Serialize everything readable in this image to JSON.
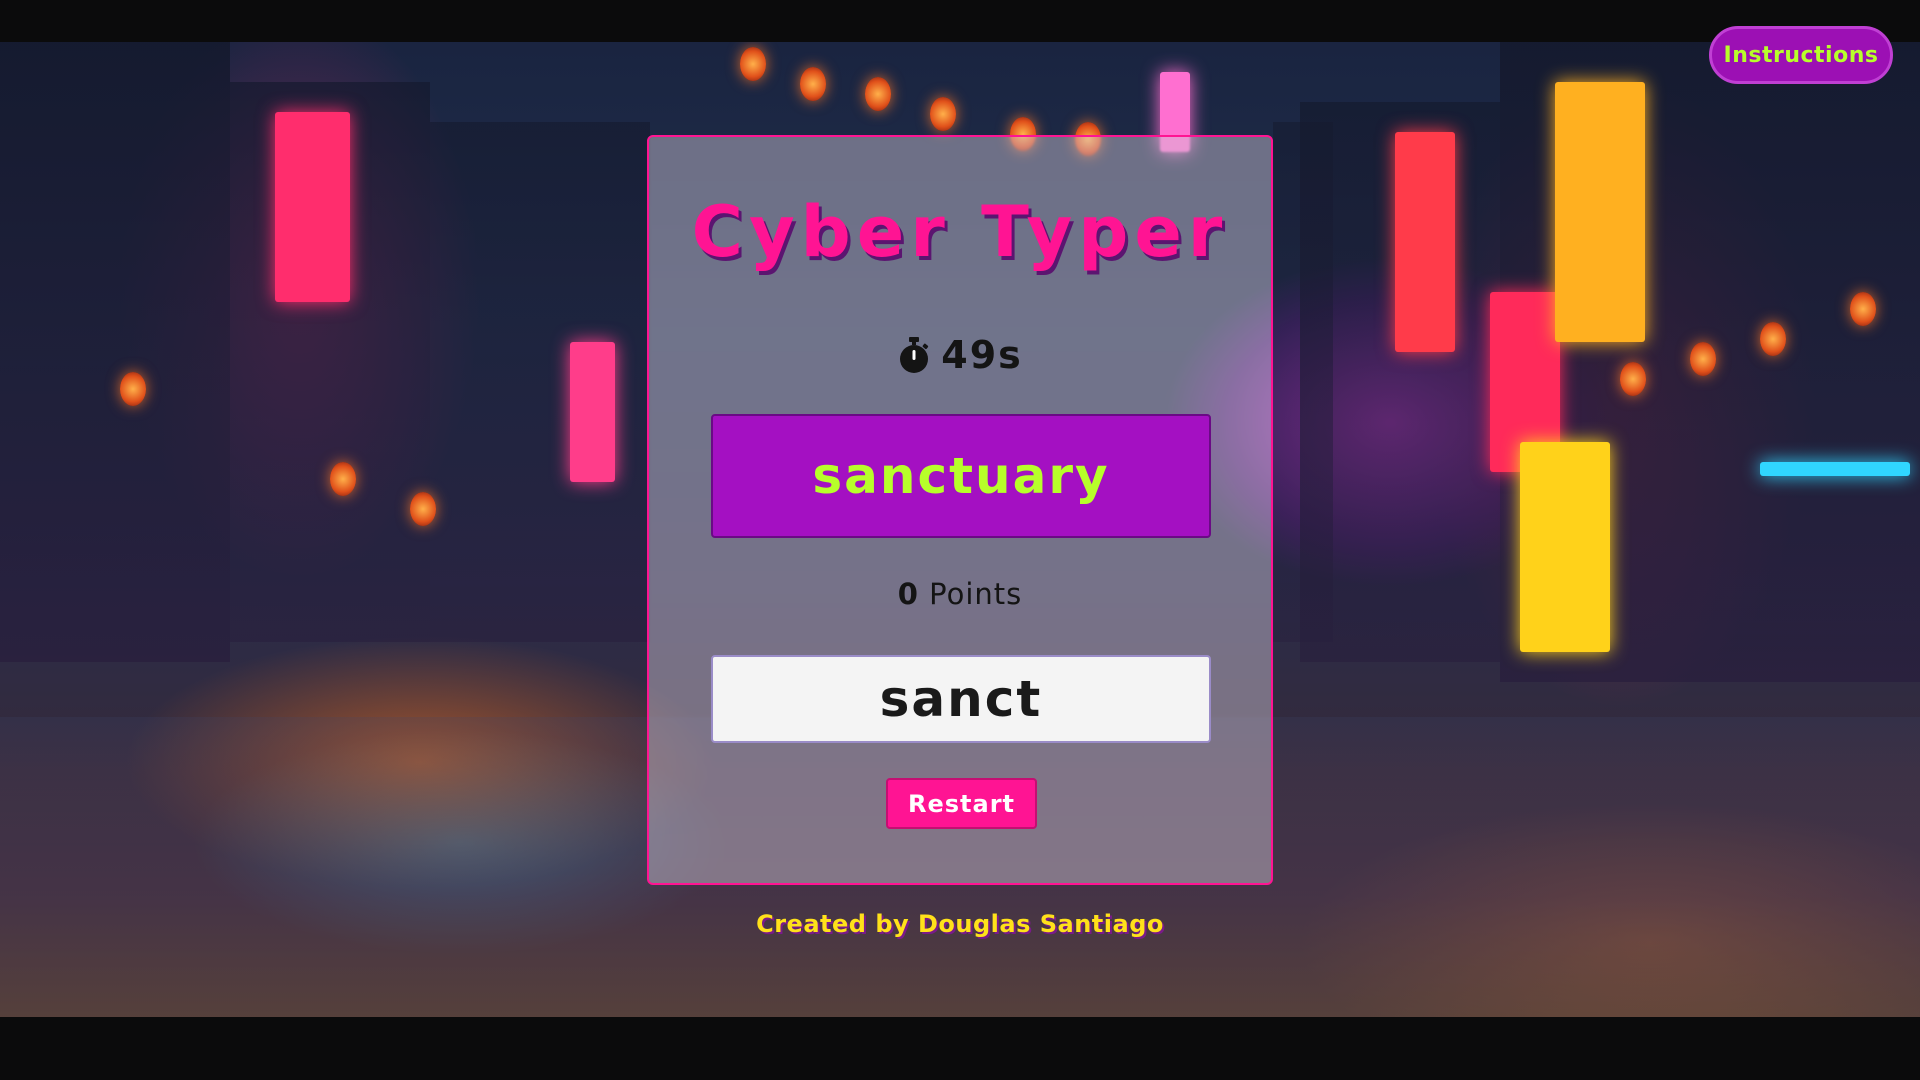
{
  "header": {
    "instructions_label": "Instructions"
  },
  "game": {
    "title": "Cyber Typer",
    "timer_value": "49s",
    "current_word": "sanctuary",
    "points_value": "0",
    "points_label": "Points",
    "input_value": "sanct",
    "restart_label": "Restart"
  },
  "footer": {
    "credit": "Created by Douglas Santiago"
  },
  "colors": {
    "accent_pink": "#ff1493",
    "word_box_purple": "#a410c2",
    "word_text_green": "#b7ff2a",
    "credit_yellow": "#ffe11a"
  },
  "icons": {
    "timer": "stopwatch-icon"
  }
}
